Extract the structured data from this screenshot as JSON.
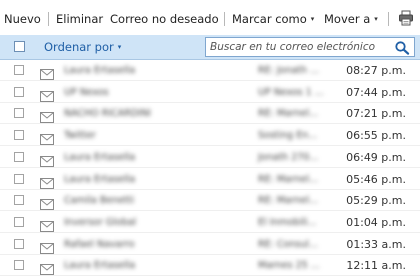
{
  "toolbar": {
    "new_label": "Nuevo",
    "delete_label": "Eliminar",
    "junk_label": "Correo no deseado",
    "mark_as_label": "Marcar como",
    "move_to_label": "Mover a",
    "caret": "▾"
  },
  "header": {
    "sort_label": "Ordenar por",
    "caret": "▾",
    "search_placeholder": "Buscar en tu correo electrónico"
  },
  "messages": [
    {
      "sender": "Laura Ertasella",
      "subject": "RE: Jonath ...",
      "time": "08:27 p.m."
    },
    {
      "sender": "UP Nexos",
      "subject": "UP Nexos 1 ...",
      "time": "07:44 p.m."
    },
    {
      "sender": "NACHO RICARDINI",
      "subject": "RE: Marnel...",
      "time": "07:21 p.m."
    },
    {
      "sender": "Twitter",
      "subject": "Sosting En...",
      "time": "06:55 p.m."
    },
    {
      "sender": "Laura Ertasella",
      "subject": "Jonath 270...",
      "time": "06:49 p.m."
    },
    {
      "sender": "Laura Ertasella",
      "subject": "RE: Marnel...",
      "time": "05:46 p.m."
    },
    {
      "sender": "Camila Benetti",
      "subject": "RE: Marnel...",
      "time": "05:29 p.m."
    },
    {
      "sender": "Inversor Global",
      "subject": "El Inmobili...",
      "time": "01:04 p.m."
    },
    {
      "sender": "Rafael Navarro",
      "subject": "RE: Consul...",
      "time": "01:33 a.m."
    },
    {
      "sender": "Laura Ertasella",
      "subject": "Marnes 25 ...",
      "time": "12:11 a.m."
    }
  ]
}
